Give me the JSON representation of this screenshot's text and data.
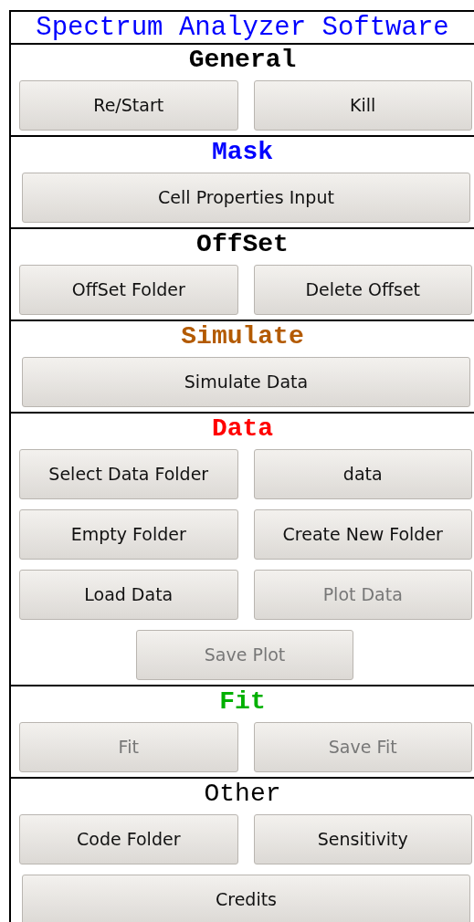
{
  "window": {
    "title": "Spectrum Analyzer Software"
  },
  "sections": [
    {
      "heading": "General",
      "color": "#000000",
      "bold": true,
      "rows": [
        {
          "kind": "pair",
          "buttons": [
            {
              "label": "Re/Start",
              "disabled": false
            },
            {
              "label": "Kill",
              "disabled": false
            }
          ]
        }
      ]
    },
    {
      "heading": "Mask",
      "color": "#0000ff",
      "bold": true,
      "rows": [
        {
          "kind": "full",
          "buttons": [
            {
              "label": "Cell Properties Input",
              "disabled": false
            }
          ]
        }
      ]
    },
    {
      "heading": "OffSet",
      "color": "#000000",
      "bold": true,
      "rows": [
        {
          "kind": "pair",
          "buttons": [
            {
              "label": "OffSet Folder",
              "disabled": false
            },
            {
              "label": "Delete Offset",
              "disabled": false
            }
          ]
        }
      ]
    },
    {
      "heading": "Simulate",
      "color": "#b35a00",
      "bold": true,
      "rows": [
        {
          "kind": "full",
          "buttons": [
            {
              "label": "Simulate Data",
              "disabled": false
            }
          ]
        }
      ]
    },
    {
      "heading": "Data",
      "color": "#ff0000",
      "bold": true,
      "rows": [
        {
          "kind": "pair",
          "buttons": [
            {
              "label": "Select Data Folder",
              "disabled": false
            },
            {
              "label": "data",
              "disabled": false
            }
          ]
        },
        {
          "kind": "pair",
          "buttons": [
            {
              "label": "Empty Folder",
              "disabled": false
            },
            {
              "label": "Create New Folder",
              "disabled": false
            }
          ]
        },
        {
          "kind": "pair",
          "buttons": [
            {
              "label": "Load Data",
              "disabled": false
            },
            {
              "label": "Plot Data",
              "disabled": true
            }
          ]
        },
        {
          "kind": "centered",
          "buttons": [
            {
              "label": "Save Plot",
              "disabled": true
            }
          ]
        }
      ]
    },
    {
      "heading": "Fit",
      "color": "#00b000",
      "bold": true,
      "rows": [
        {
          "kind": "pair",
          "buttons": [
            {
              "label": "Fit",
              "disabled": true
            },
            {
              "label": "Save Fit",
              "disabled": true
            }
          ]
        }
      ]
    },
    {
      "heading": "Other",
      "color": "#000000",
      "bold": false,
      "rows": [
        {
          "kind": "pair",
          "buttons": [
            {
              "label": "Code Folder",
              "disabled": false
            },
            {
              "label": "Sensitivity",
              "disabled": false
            }
          ]
        },
        {
          "kind": "full",
          "buttons": [
            {
              "label": "Credits",
              "disabled": false
            }
          ]
        }
      ]
    }
  ]
}
